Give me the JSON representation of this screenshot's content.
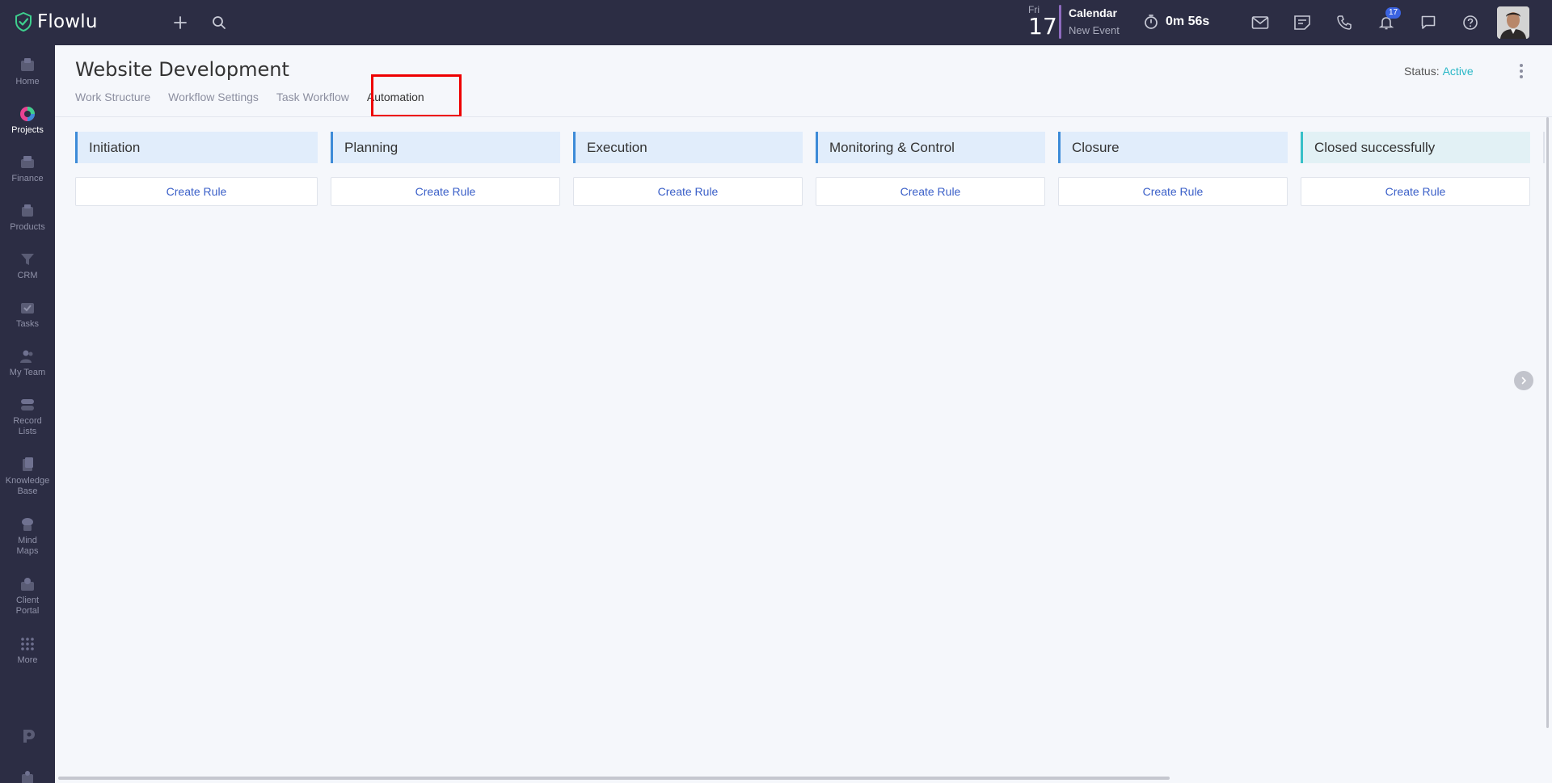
{
  "app": {
    "name": "Flowlu",
    "accent": "#2bb8c7",
    "brand_bg": "#2c2d44"
  },
  "topbar": {
    "date": {
      "dow": "Fri",
      "day": "17"
    },
    "calendar": {
      "title": "Calendar",
      "subtitle": "New Event"
    },
    "timer": "0m 56s",
    "notifications_count": "17",
    "icons": [
      "plus-icon",
      "search-icon",
      "timer-icon",
      "mail-icon",
      "notes-icon",
      "phone-icon",
      "bell-icon",
      "chat-icon",
      "help-icon"
    ]
  },
  "sidebar": {
    "items": [
      {
        "label": "Home",
        "icon": "home-icon"
      },
      {
        "label": "Projects",
        "icon": "projects-icon",
        "active": true
      },
      {
        "label": "Finance",
        "icon": "finance-icon"
      },
      {
        "label": "Products",
        "icon": "products-icon"
      },
      {
        "label": "CRM",
        "icon": "crm-icon"
      },
      {
        "label": "Tasks",
        "icon": "tasks-icon"
      },
      {
        "label": "My Team",
        "icon": "team-icon"
      },
      {
        "label": "Record Lists",
        "icon": "record-lists-icon"
      },
      {
        "label": "Knowledge Base",
        "icon": "knowledge-base-icon"
      },
      {
        "label": "Mind Maps",
        "icon": "mind-maps-icon"
      },
      {
        "label": "Client Portal",
        "icon": "client-portal-icon"
      },
      {
        "label": "More",
        "icon": "more-icon"
      }
    ]
  },
  "page": {
    "title": "Website Development",
    "tabs": [
      {
        "label": "Work Structure"
      },
      {
        "label": "Workflow Settings"
      },
      {
        "label": "Task Workflow"
      },
      {
        "label": "Automation",
        "active": true
      }
    ],
    "status_label": "Status:",
    "status_value": "Active"
  },
  "stages": [
    {
      "name": "Initiation",
      "button": "Create Rule"
    },
    {
      "name": "Planning",
      "button": "Create Rule"
    },
    {
      "name": "Execution",
      "button": "Create Rule"
    },
    {
      "name": "Monitoring & Control",
      "button": "Create Rule"
    },
    {
      "name": "Closure",
      "button": "Create Rule"
    },
    {
      "name": "Closed successfully",
      "button": "Create Rule"
    }
  ]
}
